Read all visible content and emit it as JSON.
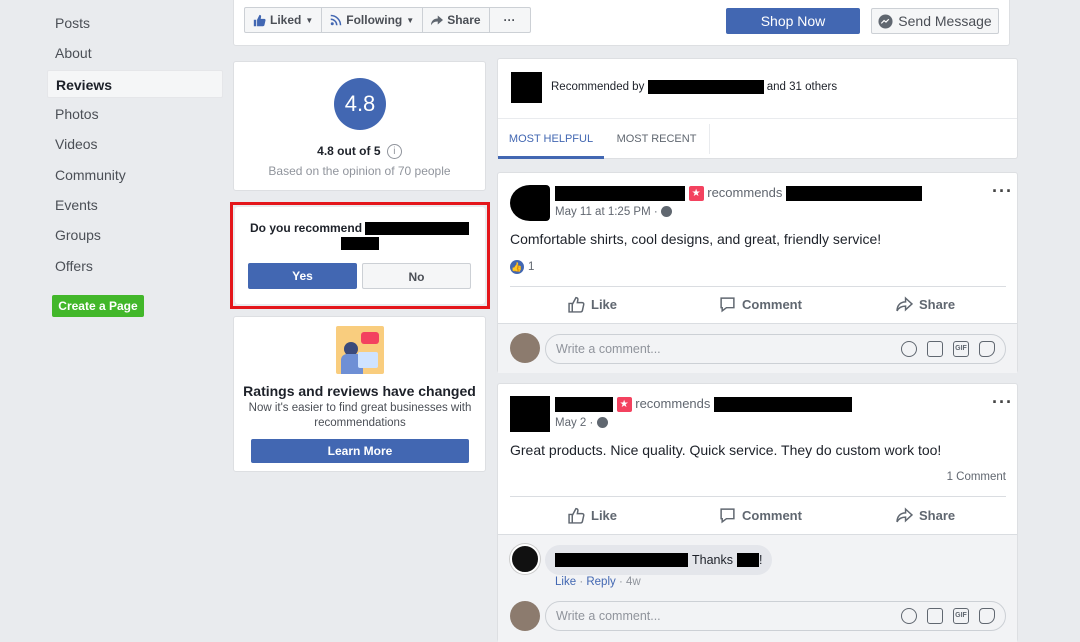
{
  "nav": {
    "items": [
      {
        "label": "Posts",
        "active": false
      },
      {
        "label": "About",
        "active": false
      },
      {
        "label": "Reviews",
        "active": true
      },
      {
        "label": "Photos",
        "active": false
      },
      {
        "label": "Videos",
        "active": false
      },
      {
        "label": "Community",
        "active": false
      },
      {
        "label": "Events",
        "active": false
      },
      {
        "label": "Groups",
        "active": false
      },
      {
        "label": "Offers",
        "active": false
      }
    ],
    "create_page": "Create a Page"
  },
  "topbar": {
    "liked": "Liked",
    "following": "Following",
    "share": "Share",
    "more": "···",
    "shop_now": "Shop Now",
    "send_message": "Send Message"
  },
  "rating": {
    "score": "4.8",
    "summary": "4.8 out of 5",
    "based_on": "Based on the opinion of 70 people"
  },
  "recommend": {
    "question": "Do you recommend",
    "yes": "Yes",
    "no": "No"
  },
  "promo": {
    "title": "Ratings and reviews have changed",
    "body": "Now it's easier to find great businesses with recommendations",
    "button": "Learn More"
  },
  "recommended_by": {
    "prefix": "Recommended by",
    "suffix": "and 31 others"
  },
  "tabs": [
    "MOST HELPFUL",
    "MOST RECENT"
  ],
  "reviews": [
    {
      "verb": "recommends",
      "time": "May 11 at 1:25 PM · ",
      "text": "Comfortable shirts, cool designs, and great, friendly service!",
      "likes": "1",
      "like": "Like",
      "comment": "Comment",
      "share": "Share",
      "comment_placeholder": "Write a comment..."
    },
    {
      "verb": "recommends",
      "time": "May 2 · ",
      "text": "Great products. Nice quality. Quick service. They do custom work too!",
      "comments_count": "1 Comment",
      "like": "Like",
      "comment": "Comment",
      "share": "Share",
      "reply": {
        "text": "Thanks",
        "end": "!",
        "like": "Like",
        "reply": "Reply",
        "age": "4w"
      },
      "comment_placeholder": "Write a comment..."
    }
  ],
  "colors": {
    "brand": "#4267b2",
    "green": "#42b72a",
    "highlight": "#e4161b",
    "star_badge": "#f3425f"
  }
}
